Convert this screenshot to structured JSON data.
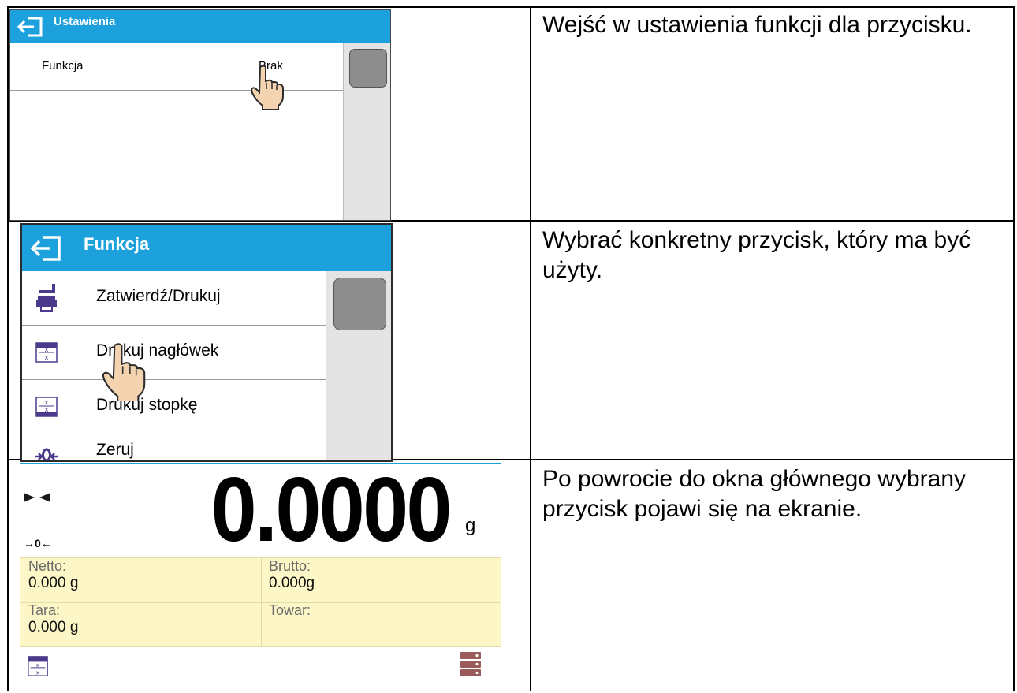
{
  "rows": [
    {
      "description": "Wejść w ustawienia funkcji dla przycisku.",
      "screen": {
        "header_title": "Ustawienia",
        "setting_label": "Funkcja",
        "setting_value": "Brak"
      }
    },
    {
      "description": "Wybrać konkretny przycisk, który ma być użyty.",
      "screen": {
        "header_title": "Funkcja",
        "items": [
          {
            "label": "Zatwierdź/Drukuj",
            "icon": "print-confirm-icon"
          },
          {
            "label": "Drukuj nagłówek",
            "icon": "print-header-icon"
          },
          {
            "label": "Drukuj stopkę",
            "icon": "print-footer-icon"
          },
          {
            "label": "Zeruj",
            "icon": "zero-icon"
          }
        ]
      }
    },
    {
      "description": "Po powrocie do okna głównego wybrany przycisk pojawi się na ekranie.",
      "screen": {
        "weight_value": "0.0000",
        "unit": "g",
        "zero_indicator": "→0←",
        "info": {
          "netto_label": "Netto:",
          "netto_value": "0.000 g",
          "brutto_label": "Brutto:",
          "brutto_value": "0.000g",
          "tara_label": "Tara:",
          "tara_value": "0.000 g",
          "towar_label": "Towar:",
          "towar_value": ""
        }
      }
    }
  ],
  "colors": {
    "header_blue": "#1da1dc",
    "info_panel": "#fdf6c6",
    "scroll_thumb": "#8d8d8d",
    "icon_purple": "#4b3a8c"
  }
}
